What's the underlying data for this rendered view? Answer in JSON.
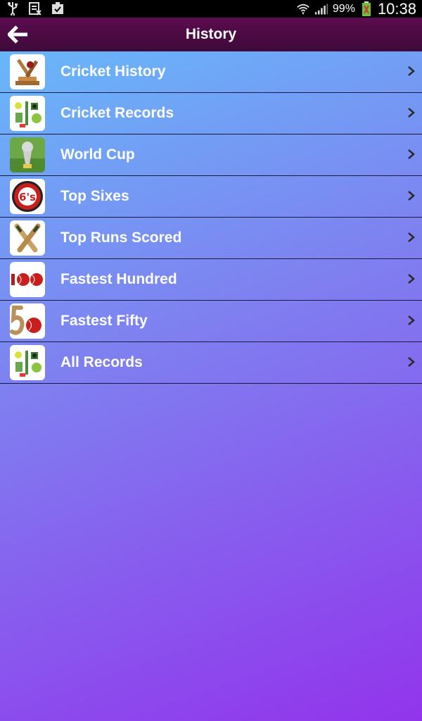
{
  "status_bar": {
    "icons_left": [
      "usb-icon",
      "sim-icon",
      "clipboard-check-icon"
    ],
    "icons_right": [
      "wifi-icon",
      "signal-icon",
      "battery-icon"
    ],
    "battery_percent": "99%",
    "time": "10:38"
  },
  "app_bar": {
    "title": "History",
    "back_icon": "back-arrow-icon"
  },
  "list": {
    "items": [
      {
        "label": "Cricket History",
        "icon": "cricket-trophy-icon"
      },
      {
        "label": "Cricket Records",
        "icon": "cricket-collage-icon"
      },
      {
        "label": "World Cup",
        "icon": "world-cup-icon"
      },
      {
        "label": "Top Sixes",
        "icon": "sixes-ball-icon"
      },
      {
        "label": "Top Runs Scored",
        "icon": "crossed-bats-icon"
      },
      {
        "label": "Fastest Hundred",
        "icon": "hundred-balls-icon"
      },
      {
        "label": "Fastest Fifty",
        "icon": "fifty-ball-icon"
      },
      {
        "label": "All Records",
        "icon": "cricket-collage-icon"
      }
    ]
  },
  "colors": {
    "app_bar": "#4a0a44",
    "gradient_top": "#64c0fb",
    "gradient_bottom": "#9234ec",
    "row_divider": "#1a1a3a",
    "label": "#ffffff"
  }
}
